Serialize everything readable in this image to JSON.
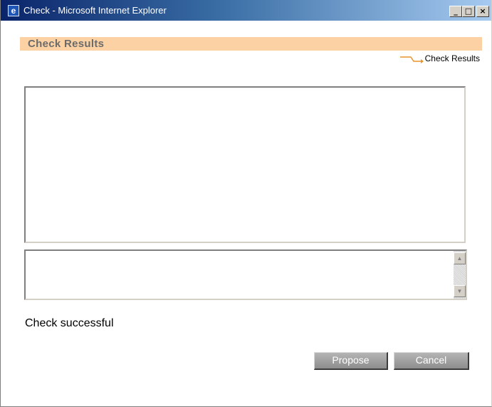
{
  "window": {
    "title": "Check - Microsoft Internet Explorer",
    "controls": {
      "minimize": "_",
      "maximize": "□",
      "close": "×"
    }
  },
  "header": {
    "title": "Check Results"
  },
  "breadcrumb": {
    "label": "Check Results",
    "icon": "arrow-right-icon"
  },
  "results": {
    "content": ""
  },
  "messages": {
    "content": "",
    "scroll_up": "▲",
    "scroll_down": "▼"
  },
  "status": {
    "text": "Check successful"
  },
  "actions": {
    "propose_label": "Propose",
    "cancel_label": "Cancel"
  },
  "colors": {
    "header_bar": "#fcd2a4",
    "breadcrumb_arrow": "#e8952a",
    "button": "#9c9c9c"
  }
}
